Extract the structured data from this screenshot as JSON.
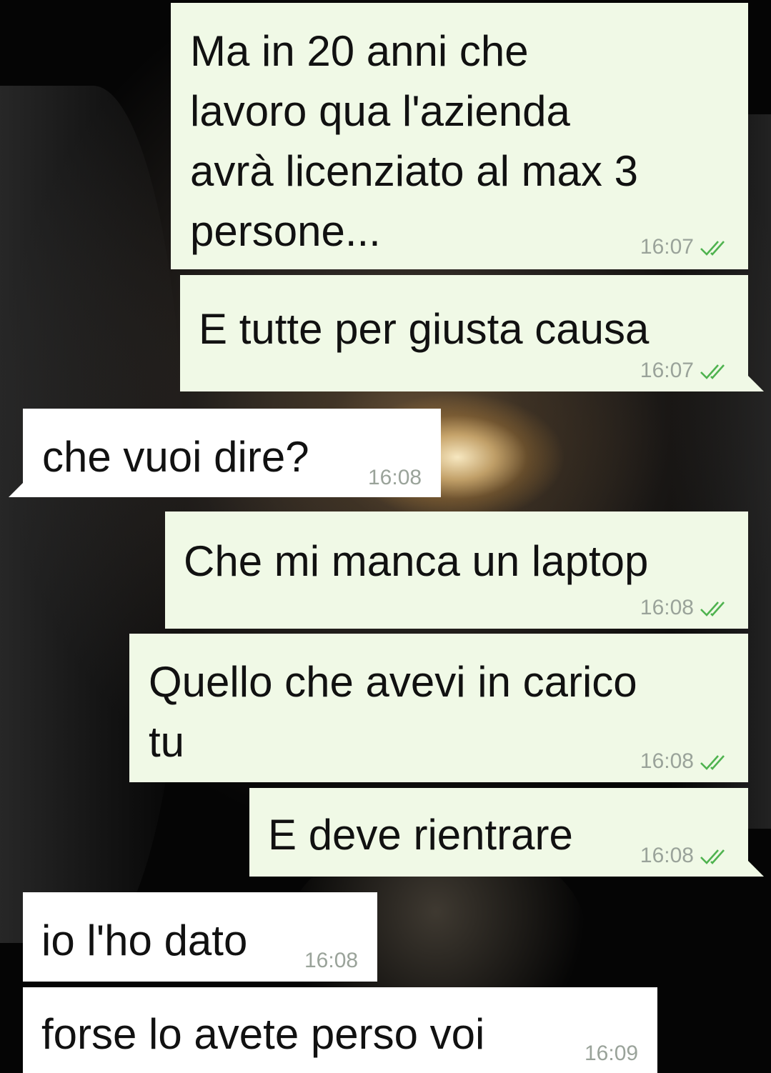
{
  "messages": [
    {
      "direction": "outgoing",
      "text": "Ma in 20 anni che\nlavoro qua l'azienda\navrà licenziato al max 3\npersone...",
      "time": "16:07",
      "status": "read"
    },
    {
      "direction": "outgoing",
      "text": "E tutte per giusta causa",
      "time": "16:07",
      "status": "read"
    },
    {
      "direction": "incoming",
      "text": "che vuoi dire?",
      "time": "16:08"
    },
    {
      "direction": "outgoing",
      "text": "Che mi manca un laptop",
      "time": "16:08",
      "status": "read"
    },
    {
      "direction": "outgoing",
      "text": "Quello che avevi in carico\ntu",
      "time": "16:08",
      "status": "read"
    },
    {
      "direction": "outgoing",
      "text": "E deve rientrare",
      "time": "16:08",
      "status": "read"
    },
    {
      "direction": "incoming",
      "text": "io l'ho dato",
      "time": "16:08"
    },
    {
      "direction": "incoming",
      "text": "forse lo avete perso voi",
      "time": "16:09"
    }
  ],
  "colors": {
    "outgoing_bubble": "#f0f9e6",
    "incoming_bubble": "#ffffff",
    "read_ticks": "#4fb34f",
    "timestamp": "#9aa39a"
  },
  "icons": {
    "read_status": "double-check-icon"
  }
}
